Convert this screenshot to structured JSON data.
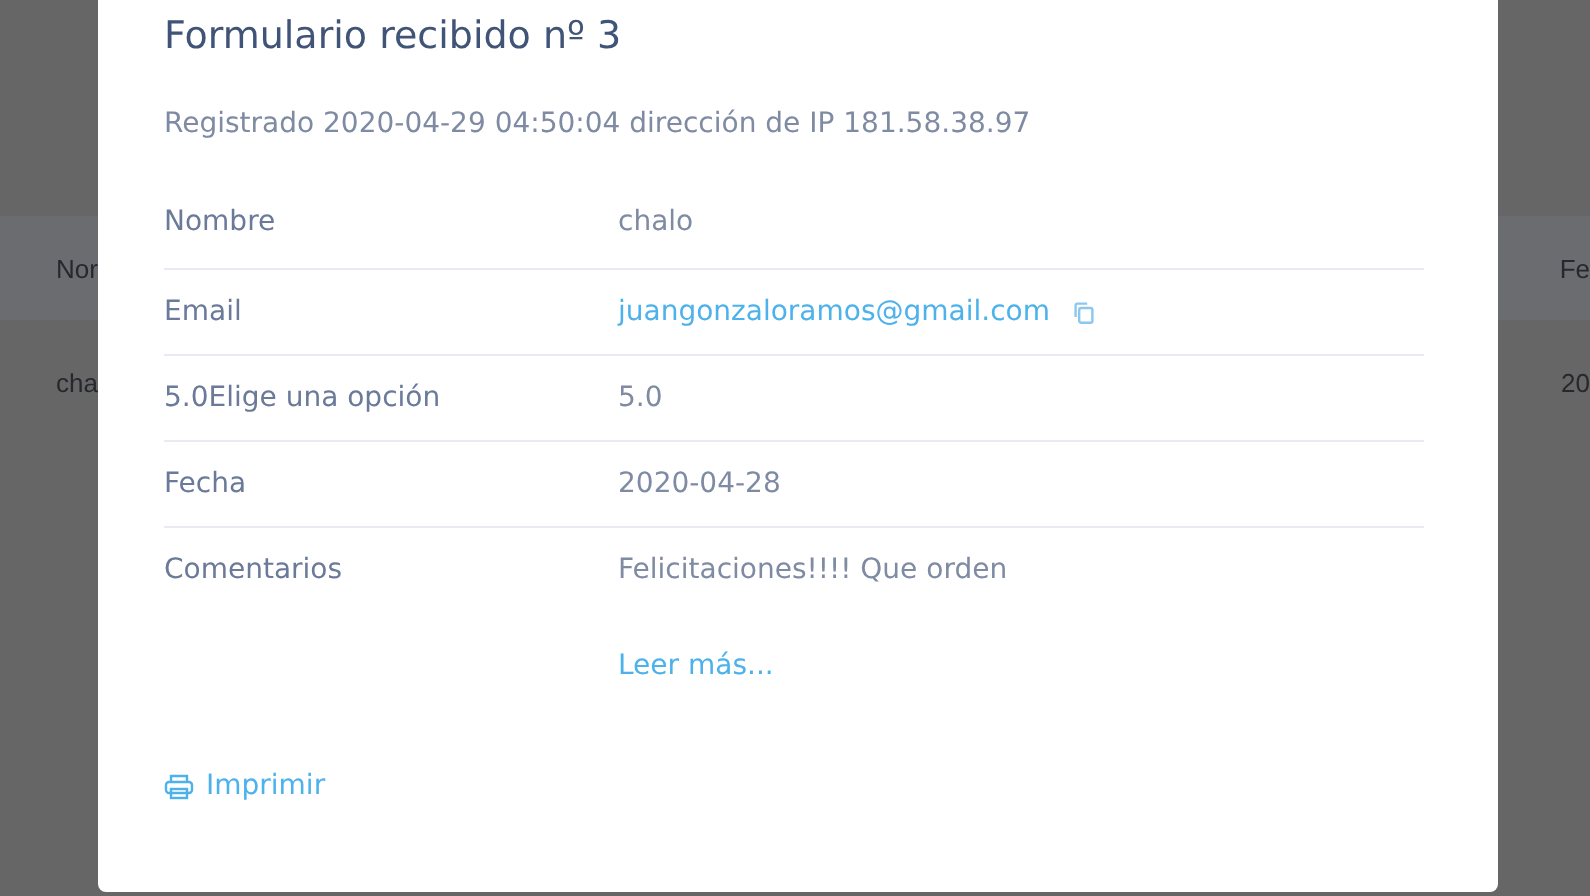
{
  "background_table": {
    "columns": [
      "Nor",
      "Fe"
    ],
    "rows": [
      [
        "cha",
        "20"
      ]
    ]
  },
  "dialog": {
    "title": "Formulario recibido nº 3",
    "subtitle": "Registrado 2020-04-29 04:50:04 dirección de IP 181.58.38.97",
    "fields": [
      {
        "label": "Nombre",
        "value": "chalo",
        "kind": "text"
      },
      {
        "label": "Email",
        "value": "juangonzaloramos@gmail.com",
        "kind": "email"
      },
      {
        "label": "5.0Elige una opción",
        "value": "5.0",
        "kind": "text"
      },
      {
        "label": "Fecha",
        "value": "2020-04-28",
        "kind": "text"
      },
      {
        "label": "Comentarios",
        "value": "Felicitaciones!!!! Que orden",
        "kind": "text",
        "more": "Leer más..."
      }
    ],
    "print_button": "Imprimir"
  }
}
